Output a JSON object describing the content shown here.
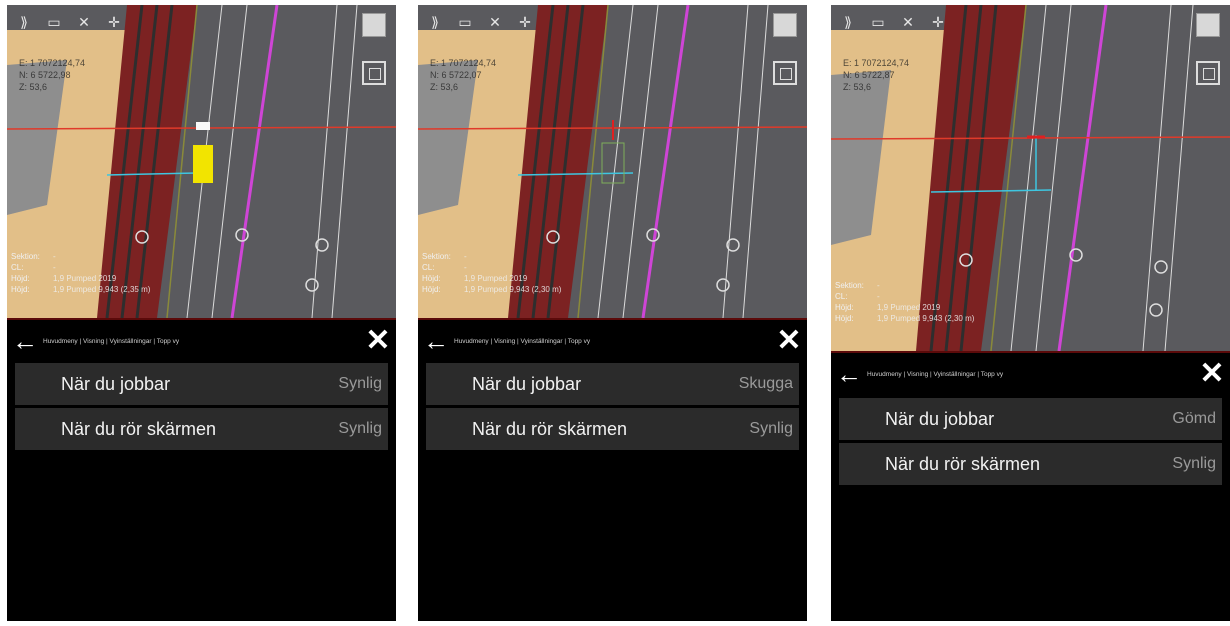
{
  "screens": [
    {
      "coords": [
        "E: 1 7072124,74",
        "N: 6 5722,98",
        "Z: 53,6"
      ],
      "readout": [
        {
          "k": "Sektion:",
          "v": "-"
        },
        {
          "k": "CL:",
          "v": "-"
        },
        {
          "k": "Höjd:",
          "v": "1,9 Pumped 2019"
        },
        {
          "k": "Höjd:",
          "v": "1,9 Pumped 9,943 (2,35 m)"
        }
      ],
      "breadcrumb": "Huvudmeny | Visning | Vyinställningar | Topp vy",
      "items": [
        {
          "label": "När du jobbar",
          "value": "Synlig"
        },
        {
          "label": "När du rör skärmen",
          "value": "Synlig"
        }
      ],
      "machine": "yellow"
    },
    {
      "coords": [
        "E: 1 7072124,74",
        "N: 6 5722,07",
        "Z: 53,6"
      ],
      "readout": [
        {
          "k": "Sektion:",
          "v": "-"
        },
        {
          "k": "CL:",
          "v": "-"
        },
        {
          "k": "Höjd:",
          "v": "1,9 Pumped 2019"
        },
        {
          "k": "Höjd:",
          "v": "1,9 Pumped 9,943 (2,30 m)"
        }
      ],
      "breadcrumb": "Huvudmeny | Visning | Vyinställningar | Topp vy",
      "items": [
        {
          "label": "När du jobbar",
          "value": "Skugga"
        },
        {
          "label": "När du rör skärmen",
          "value": "Synlig"
        }
      ],
      "machine": "shadow"
    },
    {
      "coords": [
        "E: 1 7072124,74",
        "N: 6 5722,87",
        "Z: 53,6"
      ],
      "readout": [
        {
          "k": "Sektion:",
          "v": "-"
        },
        {
          "k": "CL:",
          "v": "-"
        },
        {
          "k": "Höjd:",
          "v": "1,9 Pumped 2019"
        },
        {
          "k": "Höjd:",
          "v": "1,9 Pumped 9,943 (2,30 m)"
        }
      ],
      "breadcrumb": "Huvudmeny | Visning | Vyinställningar | Topp vy",
      "items": [
        {
          "label": "När du jobbar",
          "value": "Gömd"
        },
        {
          "label": "När du rör skärmen",
          "value": "Synlig"
        }
      ],
      "machine": "hidden"
    }
  ],
  "icons": {
    "back": "arrow-left-icon",
    "close": "close-icon",
    "cube": "3d-view-icon",
    "target": "center-target-icon"
  },
  "colors": {
    "map_bg": "#5a5a5e",
    "sand": "#e8c58e",
    "road_red": "#8a1d1d",
    "magenta": "#d14ad8",
    "cyan": "#3ec6e0",
    "machine": "#f2e400"
  }
}
